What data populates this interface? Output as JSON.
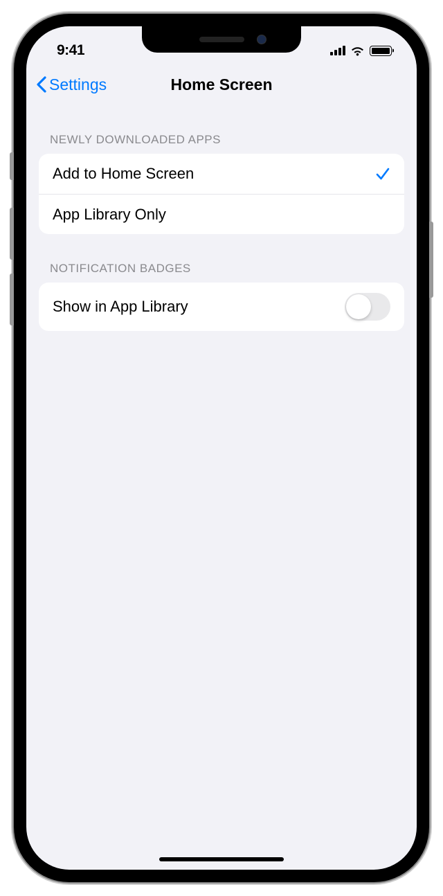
{
  "status": {
    "time": "9:41"
  },
  "nav": {
    "back_label": "Settings",
    "title": "Home Screen"
  },
  "sections": {
    "downloaded_apps": {
      "header": "NEWLY DOWNLOADED APPS",
      "option_home": "Add to Home Screen",
      "option_library": "App Library Only",
      "selected": "option_home"
    },
    "notification_badges": {
      "header": "NOTIFICATION BADGES",
      "show_in_library_label": "Show in App Library",
      "show_in_library_value": false
    }
  }
}
